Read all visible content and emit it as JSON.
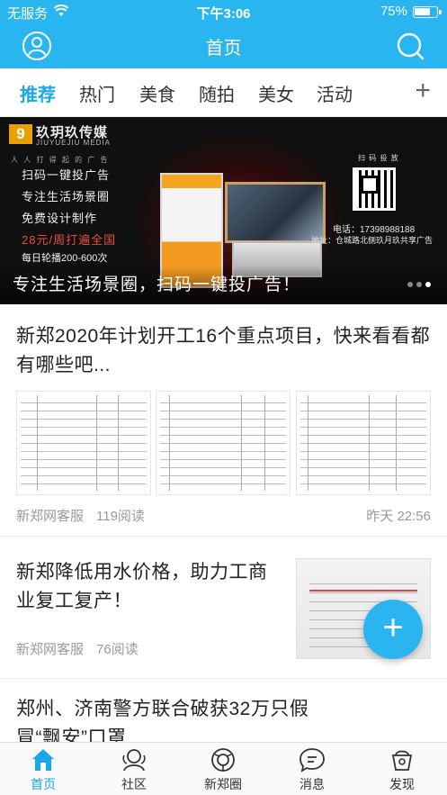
{
  "statusbar": {
    "carrier": "无服务",
    "time": "下午3:06",
    "battery_percent_text": "75%",
    "battery_level": 0.75
  },
  "navbar": {
    "title": "首页",
    "left_icon": "user-icon",
    "right_icon": "search-icon"
  },
  "tabs": {
    "items": [
      "推荐",
      "热门",
      "美食",
      "随拍",
      "美女",
      "活动"
    ],
    "active_index": 0,
    "add_label": "+"
  },
  "banner": {
    "logo_glyph": "9",
    "brand_cn": "玖玥玖传媒",
    "brand_en": "JIUYUEJIU MEDIA",
    "slogan_small": "人 人 打 得 起 的 广 告",
    "features": [
      "扫码一键投广告",
      "专注生活场景圈",
      "免费设计制作",
      "28元/周打遍全国",
      "每日轮播200-600次"
    ],
    "qr_label_top": "扫 码 投 放",
    "phone": "电话：17398988188",
    "address": "地址：仓城路北侧玖月玖共享广告",
    "caption": "专注生活场景圈，扫码一键投广告！",
    "slide_count": 3,
    "active_slide": 2
  },
  "articles": [
    {
      "title": "新郑2020年计划开工16个重点项目，快来看看都有哪些吧...",
      "source": "新郑网客服",
      "reads": "119阅读",
      "time": "昨天 22:56"
    },
    {
      "title": "新郑降低用水价格，助力工商业复工复产！",
      "source": "新郑网客服",
      "reads": "76阅读",
      "time": ""
    },
    {
      "title": "郑州、济南警方联合破获32万只假冒“飘安”口罩",
      "source": "",
      "reads": "",
      "time": ""
    }
  ],
  "fab": {
    "label": "+"
  },
  "tabbar": {
    "items": [
      {
        "label": "首页",
        "icon": "home-icon"
      },
      {
        "label": "社区",
        "icon": "community-icon"
      },
      {
        "label": "新郑圈",
        "icon": "circle-icon"
      },
      {
        "label": "消息",
        "icon": "message-icon"
      },
      {
        "label": "发现",
        "icon": "discover-icon"
      }
    ],
    "active_index": 0
  },
  "colors": {
    "primary": "#29b6f0",
    "accent_text": "#1ba8e6",
    "banner_red": "#e94c3a"
  }
}
